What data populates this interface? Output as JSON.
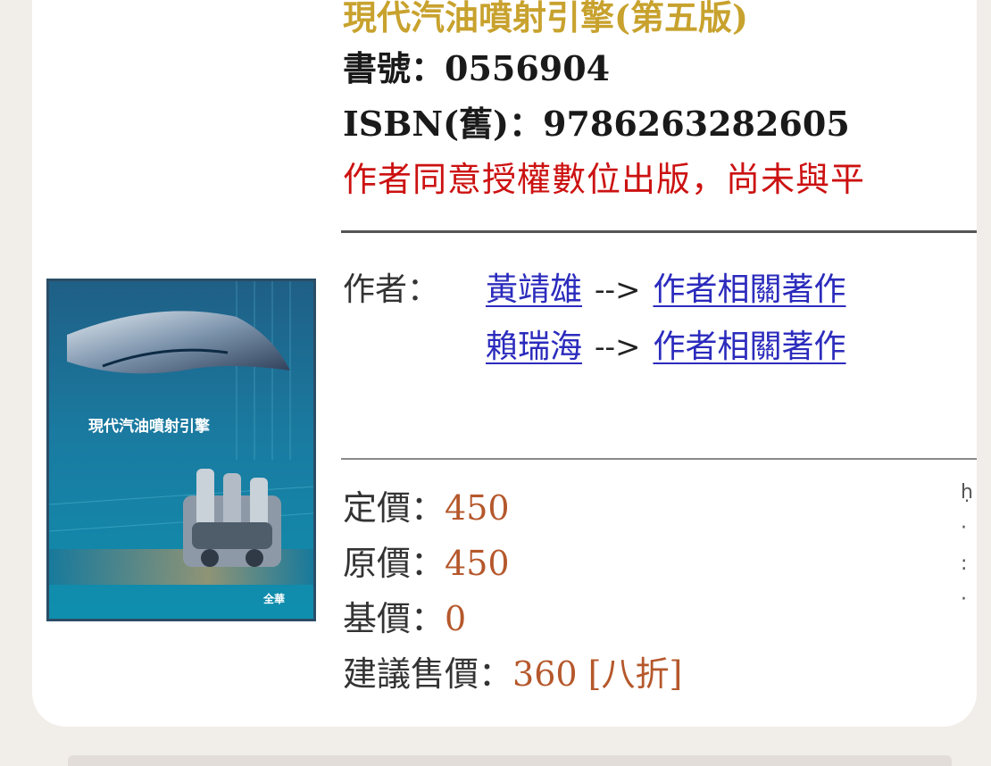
{
  "book": {
    "title": "現代汽油噴射引擎(第五版)",
    "book_no_label": "書號：",
    "book_no": "0556904",
    "isbn_label": "ISBN(舊)：",
    "isbn": "9786263282605",
    "notice": "作者同意授權數位出版，尚未與平"
  },
  "cover": {
    "title": "現代汽油噴射引擎",
    "publisher_mark": "全華"
  },
  "authors": {
    "label": "作者：",
    "arrow": "-->",
    "items": [
      {
        "name": "黃靖雄",
        "related": "作者相關著作"
      },
      {
        "name": "賴瑞海",
        "related": "作者相關著作"
      }
    ]
  },
  "prices": {
    "list_label": "定價：",
    "list": "450",
    "original_label": "原價：",
    "original": "450",
    "base_label": "基價：",
    "base": "0",
    "suggested_label": "建議售價：",
    "suggested": "360 [八折]"
  },
  "colors": {
    "title": "#c8a22e",
    "notice": "#cc1111",
    "link": "#2b2bbd",
    "price": "#b5582c"
  }
}
